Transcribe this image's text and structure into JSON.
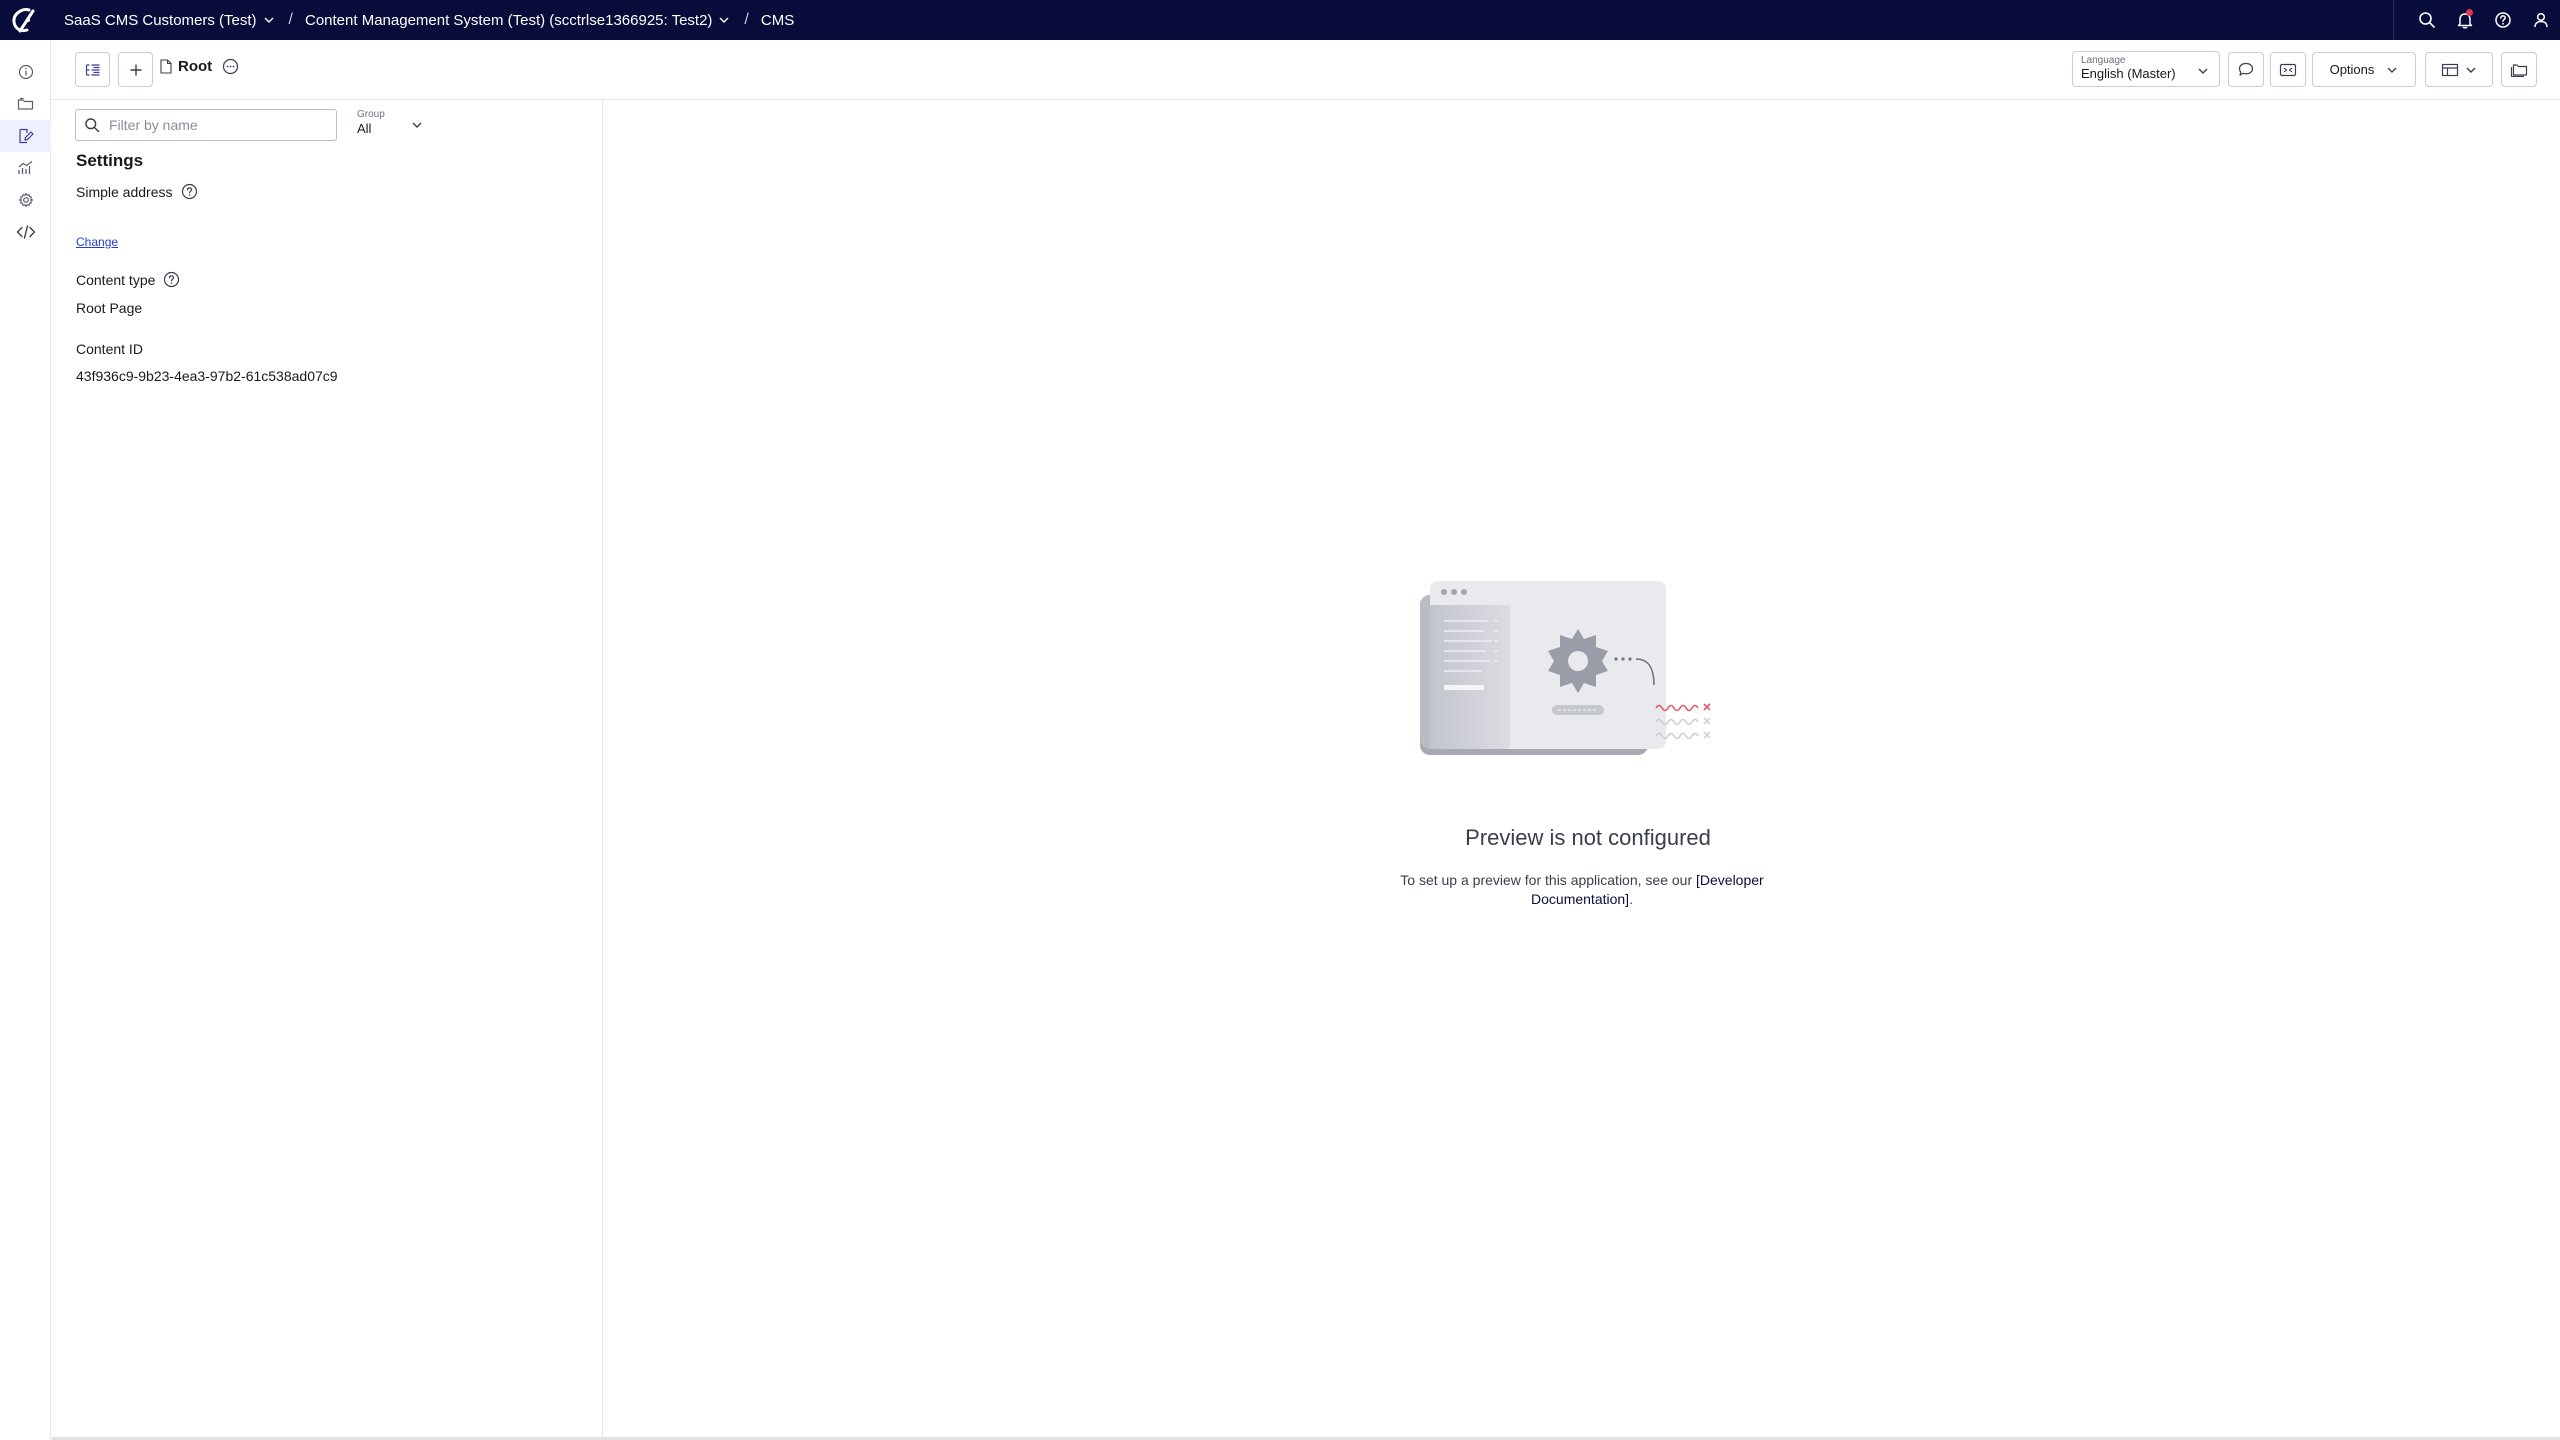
{
  "header": {
    "breadcrumbs": [
      {
        "label": "SaaS CMS Customers (Test)",
        "dropdown": true
      },
      {
        "label": "Content Management System (Test) (scctrlse1366925: Test2)",
        "dropdown": true
      },
      {
        "label": "CMS",
        "dropdown": false
      }
    ],
    "icons": [
      "search-icon",
      "bell-icon",
      "help-icon",
      "user-icon"
    ],
    "notification_dot_color": "#e0364f",
    "bar_color": "#080c3a"
  },
  "rail": {
    "items": [
      "info-icon",
      "folder-icon",
      "edit-icon",
      "analytics-icon",
      "gear-icon",
      "code-icon"
    ],
    "active_index": 2
  },
  "toolbar": {
    "page_title": "Root",
    "language": {
      "label": "Language",
      "value": "English (Master)"
    },
    "options_label": "Options"
  },
  "settings": {
    "filter_placeholder": "Filter by name",
    "group": {
      "label": "Group",
      "value": "All"
    },
    "section_title": "Settings",
    "simple_address_label": "Simple address",
    "change_link": "Change",
    "content_type_label": "Content type",
    "content_type_value": "Root Page",
    "content_id_label": "Content ID",
    "content_id_value": "43f936c9-9b23-4ea3-97b2-61c538ad07c9"
  },
  "preview": {
    "title": "Preview is not configured",
    "text_before": "To set up a preview for this application, see our ",
    "link_text": "[Developer Documentation]",
    "text_after": "."
  }
}
